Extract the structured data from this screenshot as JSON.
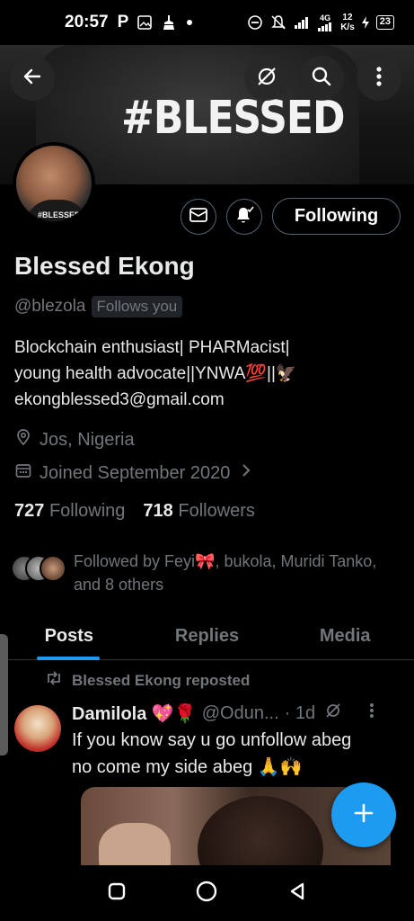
{
  "status_bar": {
    "time": "20:57",
    "network_speed_value": "12",
    "network_speed_unit": "K/s",
    "signal_label": "4G",
    "battery": "23"
  },
  "banner": {
    "text": "#BLESSED"
  },
  "avatar": {
    "shirt_text": "#BLESSED."
  },
  "profile": {
    "following_button": "Following",
    "name": "Blessed Ekong",
    "handle": "@blezola",
    "follows_you": "Follows you",
    "bio_line1": "Blockchain enthusiast| PHARMacist|",
    "bio_line2": "young health advocate||YNWA💯||🦅",
    "bio_line3": "ekongblessed3@gmail.com",
    "location": "Jos, Nigeria",
    "joined": "Joined September 2020",
    "following_count": "727",
    "following_label": "Following",
    "followers_count": "718",
    "followers_label": "Followers",
    "followed_by_line1": "Followed by Feyi🎀, bukola, Muridi Tanko,",
    "followed_by_line2": "and 8 others"
  },
  "tabs": [
    {
      "label": "Posts",
      "active": true
    },
    {
      "label": "Replies",
      "active": false
    },
    {
      "label": "Media",
      "active": false
    }
  ],
  "post": {
    "repost_label": "Blessed Ekong reposted",
    "author_name": "Damilola 💖🌹",
    "author_handle": "@Odun...",
    "time": "· 1d",
    "text_line1": "If you know say u go unfollow abeg",
    "text_line2": "no come my side abeg 🙏🙌"
  },
  "colors": {
    "accent": "#1d9bf0",
    "muted_text": "#71767b",
    "primary_text": "#e7e9ea",
    "background": "#000000"
  },
  "icons": [
    "back-arrow-icon",
    "grok-icon",
    "search-icon",
    "more-vertical-icon",
    "mail-icon",
    "bell-icon",
    "location-icon",
    "calendar-icon",
    "chevron-right-icon",
    "repost-icon",
    "compose-plus-icon",
    "nav-recents-icon",
    "nav-home-icon",
    "nav-back-icon"
  ]
}
